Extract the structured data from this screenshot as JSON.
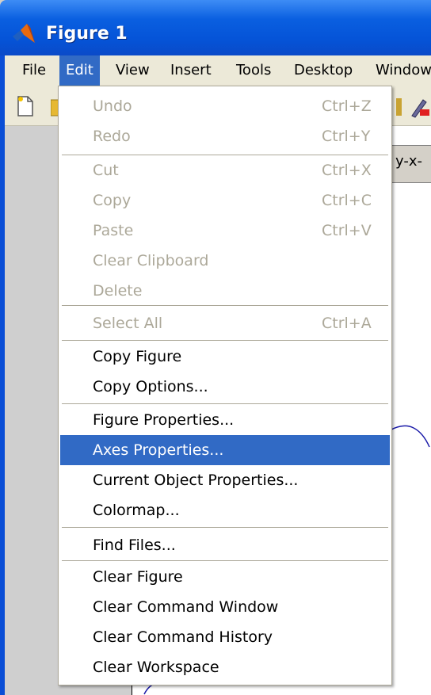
{
  "window": {
    "title": "Figure 1",
    "frame_color": "#0a4ed6",
    "titlebar_color": "#0554d8"
  },
  "menubar": {
    "items": [
      {
        "label": "File"
      },
      {
        "label": "Edit",
        "active": true
      },
      {
        "label": "View"
      },
      {
        "label": "Insert"
      },
      {
        "label": "Tools"
      },
      {
        "label": "Desktop"
      },
      {
        "label": "Window"
      }
    ],
    "highlight_color": "#316ac5"
  },
  "axes": {
    "title_fragment": "y-x-"
  },
  "edit_menu": {
    "groups": [
      [
        {
          "label": "Undo",
          "shortcut": "Ctrl+Z",
          "enabled": false
        },
        {
          "label": "Redo",
          "shortcut": "Ctrl+Y",
          "enabled": false
        }
      ],
      [
        {
          "label": "Cut",
          "shortcut": "Ctrl+X",
          "enabled": false
        },
        {
          "label": "Copy",
          "shortcut": "Ctrl+C",
          "enabled": false
        },
        {
          "label": "Paste",
          "shortcut": "Ctrl+V",
          "enabled": false
        },
        {
          "label": "Clear Clipboard",
          "shortcut": "",
          "enabled": false
        },
        {
          "label": "Delete",
          "shortcut": "",
          "enabled": false
        }
      ],
      [
        {
          "label": "Select All",
          "shortcut": "Ctrl+A",
          "enabled": false
        }
      ],
      [
        {
          "label": "Copy Figure",
          "shortcut": "",
          "enabled": true
        },
        {
          "label": "Copy Options...",
          "shortcut": "",
          "enabled": true
        }
      ],
      [
        {
          "label": "Figure Properties...",
          "shortcut": "",
          "enabled": true
        },
        {
          "label": "Axes Properties...",
          "shortcut": "",
          "enabled": true,
          "highlighted": true
        },
        {
          "label": "Current Object Properties...",
          "shortcut": "",
          "enabled": true
        },
        {
          "label": "Colormap...",
          "shortcut": "",
          "enabled": true
        }
      ],
      [
        {
          "label": "Find Files...",
          "shortcut": "",
          "enabled": true
        }
      ],
      [
        {
          "label": "Clear Figure",
          "shortcut": "",
          "enabled": true
        },
        {
          "label": "Clear Command Window",
          "shortcut": "",
          "enabled": true
        },
        {
          "label": "Clear Command History",
          "shortcut": "",
          "enabled": true
        },
        {
          "label": "Clear Workspace",
          "shortcut": "",
          "enabled": true
        }
      ]
    ]
  },
  "toolbar": {
    "icons": [
      "new-figure-icon",
      "open-file-icon",
      "data-cursor-icon",
      "insert-colorbar-icon"
    ]
  }
}
